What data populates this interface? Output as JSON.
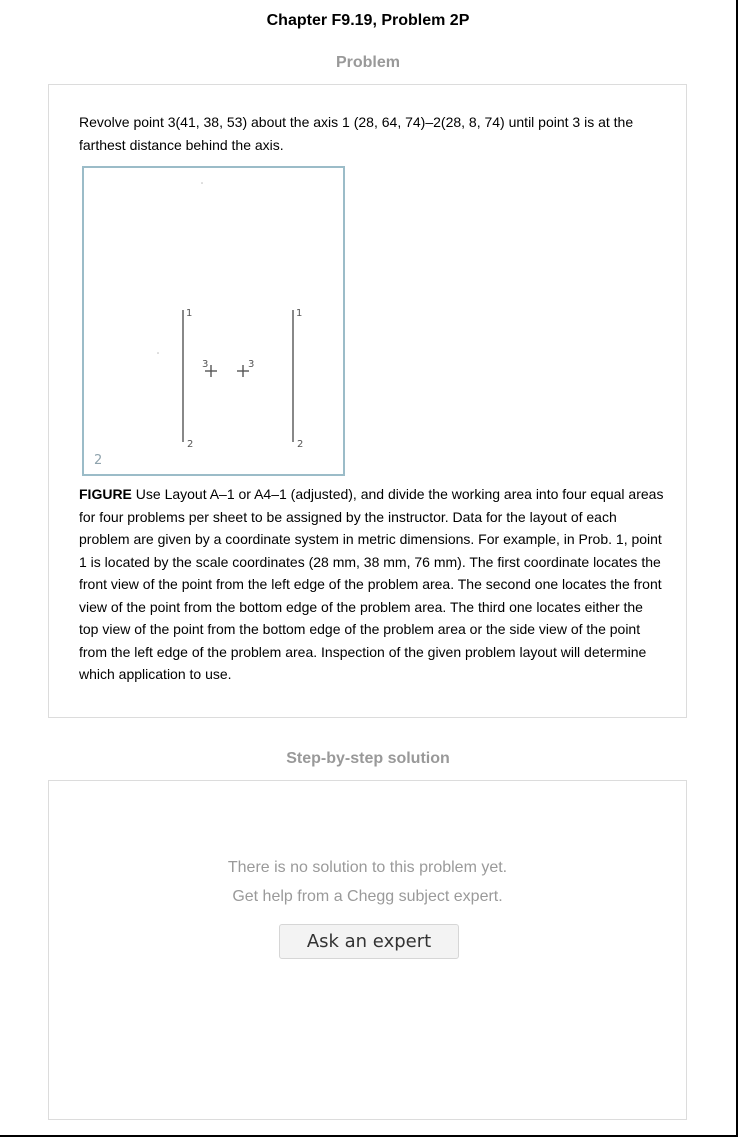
{
  "page": {
    "title": "Chapter F9.19, Problem 2P"
  },
  "problem": {
    "heading": "Problem",
    "statement": "Revolve point 3(41, 38, 53) about the axis 1 (28, 64, 74)–2(28, 8, 74) until point 3 is at the farthest distance behind the axis.",
    "figure": {
      "labels": {
        "panel_number": "2",
        "left_axis_top": "1",
        "left_axis_bottom": "2",
        "right_axis_top": "1",
        "right_axis_bottom": "2",
        "left_point": "3",
        "right_point": "3"
      },
      "line_color": "#555555",
      "border_color": "#9bbcc8"
    },
    "caption_label": "FIGURE",
    "caption_text": " Use Layout A–1 or A4–1 (adjusted), and divide the working area into four equal areas for four problems per sheet to be assigned by the instructor. Data for the layout of each problem are given by a coordinate system in metric dimensions. For example, in Prob. 1, point 1 is located by the scale coordinates (28 mm, 38 mm, 76 mm). The first coordinate locates the front view of the point from the left edge of the problem area. The second one locates the front view of the point from the bottom edge of the problem area. The third one locates either the top view of the point from the bottom edge of the problem area or the side view of the point from the left edge of the problem area. Inspection of the given problem layout will determine which application to use."
  },
  "solution": {
    "heading": "Step-by-step solution",
    "empty_line_1": "There is no solution to this problem yet.",
    "empty_line_2": "Get help from a Chegg subject expert.",
    "ask_button_label": "Ask an expert"
  }
}
